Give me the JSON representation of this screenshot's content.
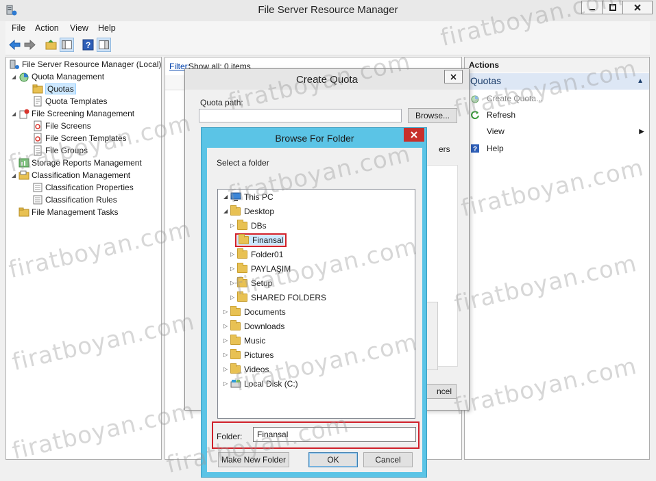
{
  "window": {
    "title": "File Server Resource Manager"
  },
  "menu": [
    "File",
    "Action",
    "View",
    "Help"
  ],
  "tree": {
    "items": [
      {
        "label": "File Server Resource Manager (Local)"
      },
      {
        "label": "Quota Management"
      },
      {
        "label": "Quotas"
      },
      {
        "label": "Quota Templates"
      },
      {
        "label": "File Screening Management"
      },
      {
        "label": "File Screens"
      },
      {
        "label": "File Screen Templates"
      },
      {
        "label": "File Groups"
      },
      {
        "label": "Storage Reports Management"
      },
      {
        "label": "Classification Management"
      },
      {
        "label": "Classification Properties"
      },
      {
        "label": "Classification Rules"
      },
      {
        "label": "File Management Tasks"
      }
    ]
  },
  "middle": {
    "filter_link": "Filter:",
    "filter_text": "Show all: 0 items"
  },
  "actions": {
    "header": "Actions",
    "section": "Quotas",
    "items": [
      {
        "label": "Create Quota..."
      },
      {
        "label": "Refresh"
      },
      {
        "label": "View"
      },
      {
        "label": "Help"
      }
    ]
  },
  "create_quota": {
    "title": "Create Quota",
    "path_label": "Quota path:",
    "browse_label": "Browse...",
    "partial_text": "ers",
    "cancel_partial": "ncel"
  },
  "browse_folder": {
    "title": "Browse For Folder",
    "select_label": "Select a folder",
    "items": [
      {
        "label": "This PC"
      },
      {
        "label": "Desktop"
      },
      {
        "label": "DBs"
      },
      {
        "label": "Finansal"
      },
      {
        "label": "Folder01"
      },
      {
        "label": "PAYLAŞIM"
      },
      {
        "label": "Setup"
      },
      {
        "label": "SHARED FOLDERS"
      },
      {
        "label": "Documents"
      },
      {
        "label": "Downloads"
      },
      {
        "label": "Music"
      },
      {
        "label": "Pictures"
      },
      {
        "label": "Videos"
      },
      {
        "label": "Local Disk (C:)"
      }
    ],
    "folder_label": "Folder:",
    "folder_value": "Finansal",
    "new_folder_label": "Make New Folder",
    "ok_label": "OK",
    "cancel_label": "Cancel"
  },
  "watermark": "firatboyan.com"
}
